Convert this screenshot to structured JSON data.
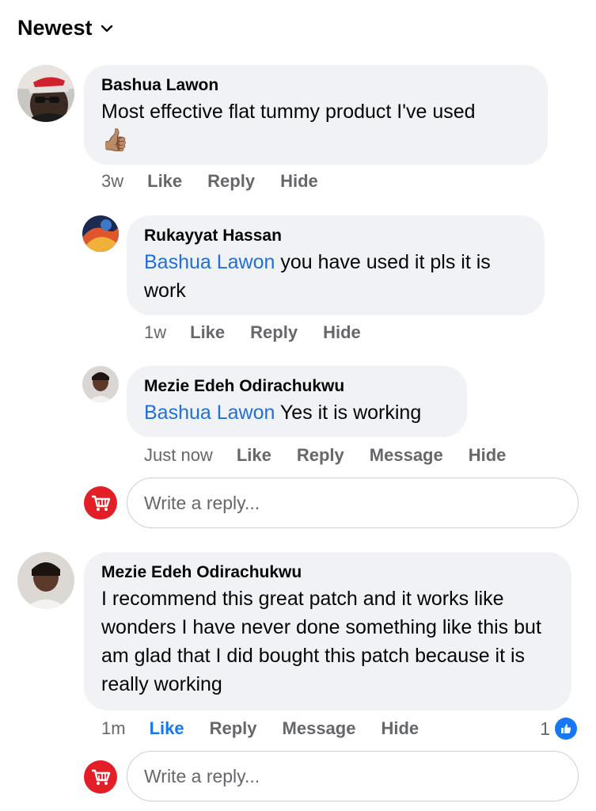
{
  "sort": {
    "label": "Newest"
  },
  "comments": [
    {
      "author": "Bashua Lawon",
      "text": "Most effective flat tummy product I've used",
      "emoji": "👍🏽",
      "time": "3w",
      "actions": [
        "Like",
        "Reply",
        "Hide"
      ],
      "replies": [
        {
          "author": "Rukayyat Hassan",
          "mention": "Bashua Lawon",
          "text": " you have used it pls it is work",
          "time": "1w",
          "actions": [
            "Like",
            "Reply",
            "Hide"
          ]
        },
        {
          "author": "Mezie Edeh Odirachukwu",
          "mention": "Bashua Lawon",
          "text": " Yes it is working",
          "time": "Just now",
          "actions": [
            "Like",
            "Reply",
            "Message",
            "Hide"
          ]
        }
      ],
      "reply_placeholder": "Write a reply..."
    },
    {
      "author": "Mezie Edeh Odirachukwu",
      "text": "I recommend this great patch and it works like wonders I have never done something like this but am glad that I did bought this patch because it is really working",
      "time": "1m",
      "actions": [
        "Like",
        "Reply",
        "Message",
        "Hide"
      ],
      "reaction_count": "1",
      "reply_placeholder": "Write a reply..."
    }
  ],
  "colors": {
    "accent": "#1877f2",
    "mention": "#216fdb",
    "bubble": "#f0f2f5",
    "shop_icon": "#e41e26"
  }
}
